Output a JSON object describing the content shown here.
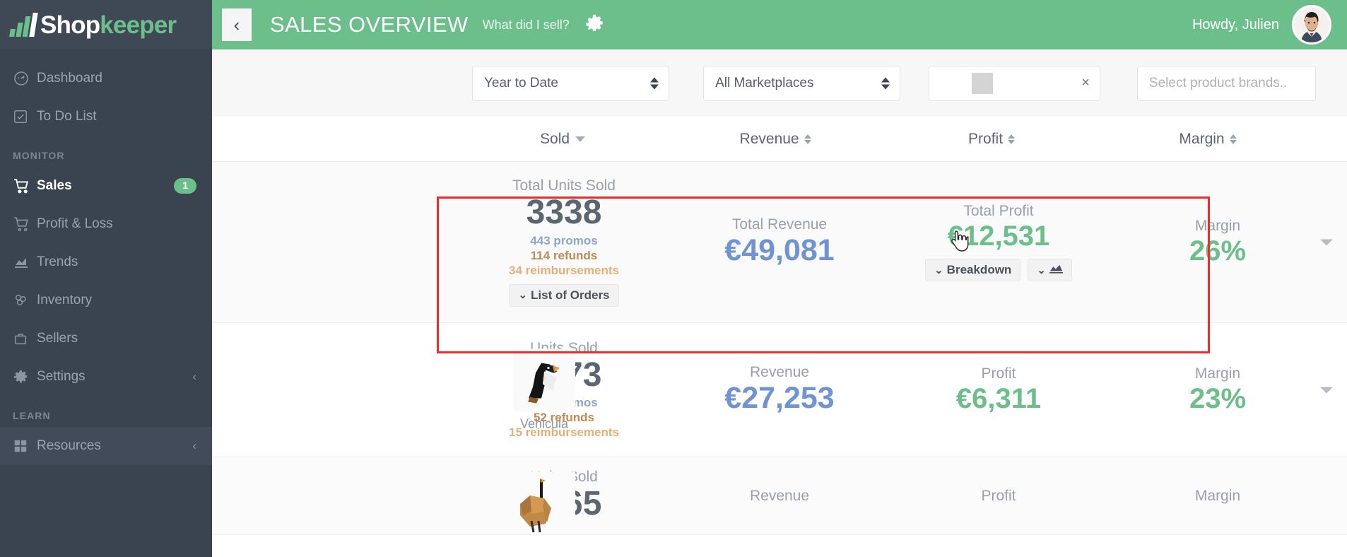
{
  "brand": {
    "name_part1": "Shop",
    "name_part2": "keeper",
    "logo_icon": "bar-chart-logo-icon",
    "accent_green": "#6cbf8b",
    "sidebar_bg": "#3a4451"
  },
  "sidebar": {
    "items": [
      {
        "label": "Dashboard",
        "icon": "dashboard-gauge-icon",
        "active": false
      },
      {
        "label": "To Do List",
        "icon": "checkbox-icon",
        "active": false
      }
    ],
    "sections": [
      {
        "label": "MONITOR",
        "items": [
          {
            "label": "Sales",
            "icon": "shopping-cart-icon",
            "active": true,
            "badge": "1"
          },
          {
            "label": "Profit & Loss",
            "icon": "shopping-cart-icon",
            "active": false
          },
          {
            "label": "Trends",
            "icon": "chart-area-icon",
            "active": false
          },
          {
            "label": "Inventory",
            "icon": "boxes-icon",
            "active": false
          },
          {
            "label": "Sellers",
            "icon": "briefcase-icon",
            "active": false
          },
          {
            "label": "Settings",
            "icon": "gear-icon",
            "active": false,
            "chevron": "‹"
          }
        ]
      },
      {
        "label": "LEARN",
        "items": [
          {
            "label": "Resources",
            "icon": "grid-icon",
            "active": false,
            "chevron": "‹"
          }
        ]
      }
    ]
  },
  "header": {
    "collapse_icon": "chevron-left-icon",
    "collapse_glyph": "‹",
    "title": "SALES OVERVIEW",
    "subtitle": "What did I sell?",
    "settings_icon": "gear-icon",
    "greeting": "Howdy, Julien",
    "avatar_icon": "user-avatar"
  },
  "filters": {
    "date_range": {
      "value": "Year to Date",
      "icon": "updown-spinner-icon"
    },
    "marketplace": {
      "value": "All Marketplaces",
      "icon": "updown-spinner-icon"
    },
    "search_field": {
      "value": "",
      "clear_icon": "clear-x-icon",
      "clear_glyph": "×",
      "loading_chip": "loading-placeholder"
    },
    "brands": {
      "placeholder": "Select product brands.."
    }
  },
  "table": {
    "columns": [
      {
        "key": "sold",
        "label": "Sold",
        "sorted": true,
        "sort_icon": "caret-down-icon"
      },
      {
        "key": "revenue",
        "label": "Revenue",
        "sorted": false,
        "sort_icon": "sort-updown-icon"
      },
      {
        "key": "profit",
        "label": "Profit",
        "sorted": false,
        "sort_icon": "sort-updown-icon"
      },
      {
        "key": "margin",
        "label": "Margin",
        "sorted": false,
        "sort_icon": "sort-updown-icon"
      }
    ],
    "total_row": {
      "sold_label": "Total Units Sold",
      "sold_value": "3338",
      "promos": "443 promos",
      "refunds": "114 refunds",
      "reimbursements": "34 reimbursements",
      "orders_button": "List of Orders",
      "orders_button_icon": "double-chevron-down-icon",
      "revenue_label": "Total Revenue",
      "revenue_value": "€49,081",
      "profit_label": "Total Profit",
      "profit_value": "€12,531",
      "breakdown_button": "Breakdown",
      "breakdown_icon": "double-chevron-down-icon",
      "chart_button_icon": "chart-area-icon",
      "margin_label": "Margin",
      "margin_value": "26%",
      "expand_icon": "caret-down-icon"
    },
    "rows": [
      {
        "product_name": "Vehicula",
        "product_image": "puffin-origami-icon",
        "sold_label": "Units Sold",
        "sold_value": "1873",
        "promos": "189 promos",
        "refunds": "52 refunds",
        "reimbursements": "15 reimbursements",
        "revenue_label": "Revenue",
        "revenue_value": "€27,253",
        "profit_label": "Profit",
        "profit_value": "€6,311",
        "margin_label": "Margin",
        "margin_value": "23%",
        "expand_icon": "caret-down-icon"
      },
      {
        "product_name": "",
        "product_image": "ostrich-origami-icon",
        "sold_label": "Units Sold",
        "sold_value": "1465",
        "promos": "",
        "refunds": "",
        "reimbursements": "",
        "revenue_label": "Revenue",
        "revenue_value": "",
        "profit_label": "Profit",
        "profit_value": "",
        "margin_label": "Margin",
        "margin_value": "",
        "expand_icon": "caret-down-icon"
      }
    ]
  },
  "annotation": {
    "type": "red-highlight-rect",
    "color": "#f22a2a"
  },
  "cursor": {
    "type": "pointing-hand-cursor"
  }
}
